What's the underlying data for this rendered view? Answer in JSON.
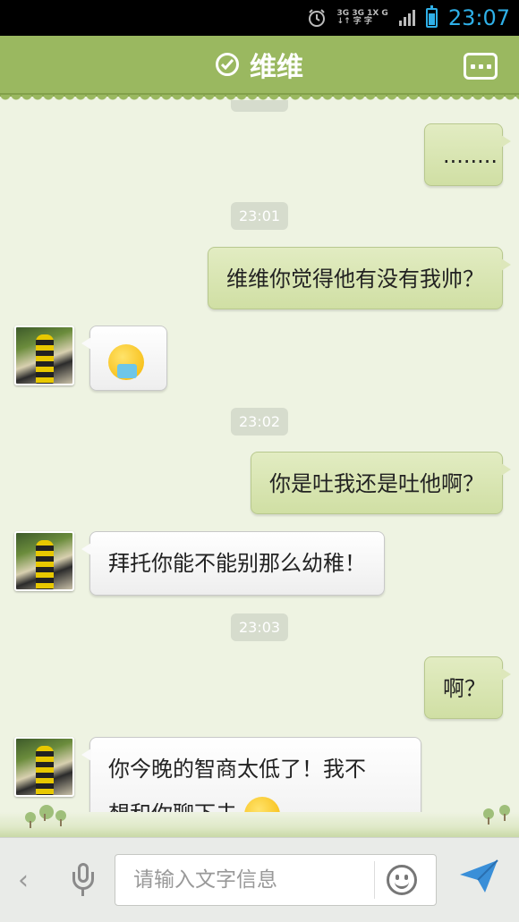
{
  "status_bar": {
    "time": "23:07",
    "network_top": "3G 3G 1X G",
    "network_bottom": "↓↑ 字 字"
  },
  "header": {
    "title": "维维"
  },
  "messages": [
    {
      "type": "out",
      "text": "........"
    },
    {
      "type": "timestamp",
      "text": "23:01"
    },
    {
      "type": "out",
      "text": "维维你觉得他有没有我帅？"
    },
    {
      "type": "in",
      "emoji": "vomit-emoji"
    },
    {
      "type": "timestamp",
      "text": "23:02"
    },
    {
      "type": "out",
      "text": "你是吐我还是吐他啊？"
    },
    {
      "type": "in",
      "text": "拜托你能不能别那么幼稚！"
    },
    {
      "type": "timestamp",
      "text": "23:03"
    },
    {
      "type": "out",
      "text": "啊？"
    },
    {
      "type": "in",
      "text_line1": "你今晚的智商太低了！我不",
      "text_line2": "想和你聊下去",
      "emoji": "sweat-emoji"
    }
  ],
  "input": {
    "placeholder": "请输入文字信息"
  },
  "colors": {
    "header_bg": "#9ab860",
    "out_bubble": "#d8e4b4",
    "in_bubble": "#f7f7f7",
    "chat_bg": "#eef3e2",
    "status_accent": "#2fb0e8",
    "send_icon": "#3a8fd8"
  },
  "icons": [
    "alarm-icon",
    "signal-icon",
    "battery-icon",
    "check-circle-icon",
    "menu-dots-icon",
    "back-chevron-icon",
    "microphone-icon",
    "emoji-icon",
    "send-icon"
  ]
}
